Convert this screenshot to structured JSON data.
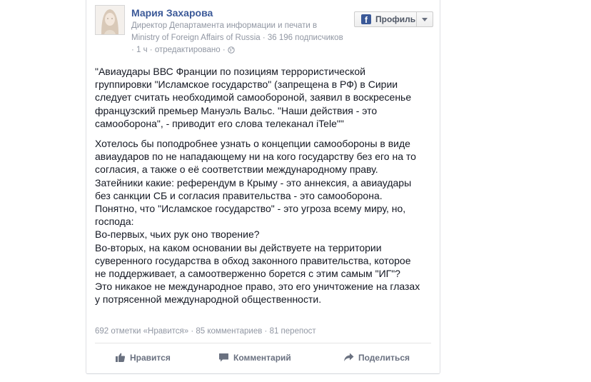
{
  "post": {
    "author": "Мария Захарова",
    "subtitle_line1": "Директор Департамента информации и печати в",
    "subtitle_line2": "Ministry of Foreign Affairs of Russia · 36 196 подписчиков",
    "meta_time": "· 1 ч · отредактировано ·",
    "meta_icon": "globe-icon",
    "profile_button": {
      "label": "Профиль",
      "icon": "facebook-logo-icon",
      "dropdown_icon": "caret-down-icon"
    },
    "quote_lines": [
      "\"Авиаудары ВВС Франции по позициям террористической",
      "группировки \"Исламское государство\" (запрещена в РФ) в Сирии",
      "следует считать необходимой самообороной, заявил в воскресенье",
      "французский премьер Мануэль Вальс. \"Наши действия - это",
      "самооборона\", - приводит его слова телеканал iTele\"\""
    ],
    "body_lines": [
      "Хотелось бы поподробнее узнать о концепции самообороны в виде",
      "авиаударов по не нападающему ни на кого государству без его на то",
      "согласия, а также о её соответствии международному праву.",
      "Затейники какие: референдум в Крыму - это аннексия, а авиаудары",
      "без санкции СБ и согласия правительства - это самооборона.",
      "Понятно, что \"Исламское государство\" - это угроза всему миру, но,",
      "господа:",
      "Во-первых, чьих рук оно творение?",
      "Во-вторых, на каком основании вы действуете на территории",
      "суверенного государства в обход законного правительства, которое",
      "не поддерживает, а самоотверженно борется с этим самым \"ИГ\"?",
      "Это никакое не международное право, это его уничтожение на глазах",
      "у потрясенной международной общественности."
    ],
    "stats": "692 отметки «Нравится» · 85 комментариев · 81 перепост",
    "actions": {
      "like": "Нравится",
      "comment": "Комментарий",
      "share": "Поделиться"
    }
  },
  "colors": {
    "link": "#3b5998",
    "meta": "#9197a3",
    "body_text": "#141823",
    "action_text": "#6a7180"
  }
}
